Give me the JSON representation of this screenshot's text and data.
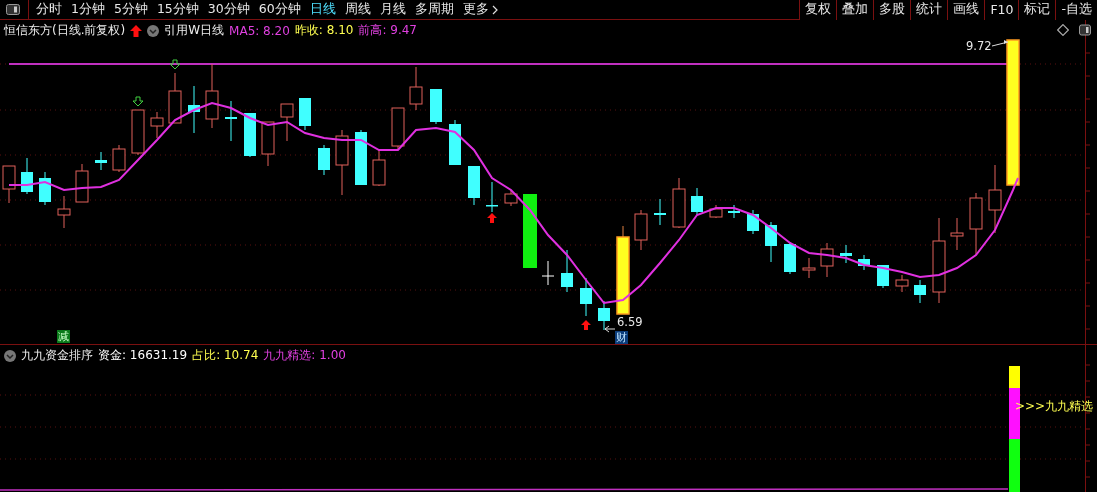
{
  "toolbar": {
    "periods": [
      {
        "label": "分时",
        "selected": false
      },
      {
        "label": "1分钟",
        "selected": false
      },
      {
        "label": "5分钟",
        "selected": false
      },
      {
        "label": "15分钟",
        "selected": false
      },
      {
        "label": "30分钟",
        "selected": false
      },
      {
        "label": "60分钟",
        "selected": false
      },
      {
        "label": "日线",
        "selected": true
      },
      {
        "label": "周线",
        "selected": false
      },
      {
        "label": "月线",
        "selected": false
      },
      {
        "label": "多周期",
        "selected": false
      }
    ],
    "more": "更多",
    "buttons": [
      "复权",
      "叠加",
      "多股",
      "统计",
      "画线",
      "F10",
      "标记",
      "-自选"
    ]
  },
  "main_chart": {
    "title": "恒信东方(日线.前复权)",
    "formula": "引用W日线",
    "indicators": [
      {
        "label": "MA5: 8.20",
        "color": "#e040e0"
      },
      {
        "label": "昨收: 8.10",
        "color": "#ffff50"
      },
      {
        "label": "前高: 9.47",
        "color": "#e040e0"
      }
    ],
    "high_label": "9.72",
    "low_label": "6.59",
    "marks": [
      {
        "kind": "reduce",
        "text": "减"
      },
      {
        "kind": "finance",
        "text": "财"
      }
    ]
  },
  "sub_chart": {
    "title": "九九资金排序",
    "indicators": [
      {
        "label": "资金: 16631.19",
        "color": "#ffffff"
      },
      {
        "label": "占比: 10.74",
        "color": "#ffff50"
      },
      {
        "label": "九九精选: 1.00",
        "color": "#e040e0"
      }
    ],
    "signal_label": ">>>九九精选"
  }
}
